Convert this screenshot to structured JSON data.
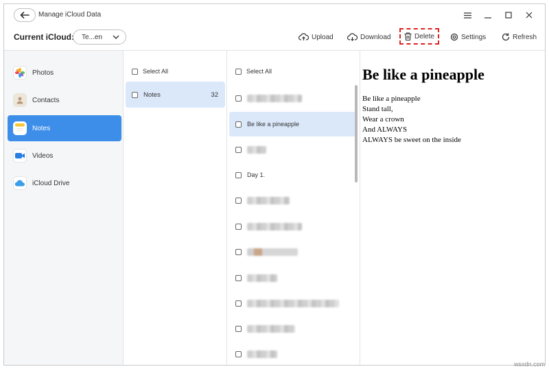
{
  "window": {
    "title": "Manage iCloud Data",
    "controls": [
      "menu-icon",
      "minimize-icon",
      "maximize-icon",
      "close-icon"
    ]
  },
  "account": {
    "label": "Current iCloud:",
    "selected": "Te...en"
  },
  "toolbar": {
    "upload": "Upload",
    "download": "Download",
    "delete": "Delete",
    "settings": "Settings",
    "refresh": "Refresh"
  },
  "nav": {
    "items": [
      {
        "label": "Photos",
        "icon": "photos-icon"
      },
      {
        "label": "Contacts",
        "icon": "contacts-icon"
      },
      {
        "label": "Notes",
        "icon": "notes-icon",
        "active": true
      },
      {
        "label": "Videos",
        "icon": "videos-icon"
      },
      {
        "label": "iCloud Drive",
        "icon": "icloud-drive-icon"
      }
    ]
  },
  "folders": {
    "select_all": "Select All",
    "items": [
      {
        "label": "Notes",
        "count": "32"
      }
    ]
  },
  "notes": {
    "select_all": "Select All",
    "items": [
      {
        "label": "",
        "blurred": true
      },
      {
        "label": "Be like a pineapple",
        "active": true
      },
      {
        "label": "",
        "blurred": true
      },
      {
        "label": "Day 1.",
        "blurred": false
      },
      {
        "label": "",
        "blurred": true
      },
      {
        "label": "",
        "blurred": true
      },
      {
        "label": "",
        "blurred": true
      },
      {
        "label": "",
        "blurred": true
      },
      {
        "label": "",
        "blurred": true
      },
      {
        "label": "",
        "blurred": true
      },
      {
        "label": "",
        "blurred": true
      }
    ]
  },
  "preview": {
    "title": "Be like a pineapple",
    "lines": [
      "Be like a pineapple",
      "Stand tall,",
      "Wear a crown",
      "And ALWAYS",
      "ALWAYS be sweet on the inside"
    ]
  },
  "watermark": "wsxdn.com",
  "colors": {
    "accent": "#3d8ee9",
    "selected_row": "#dbe8fa",
    "delete_highlight": "#dd2222"
  }
}
